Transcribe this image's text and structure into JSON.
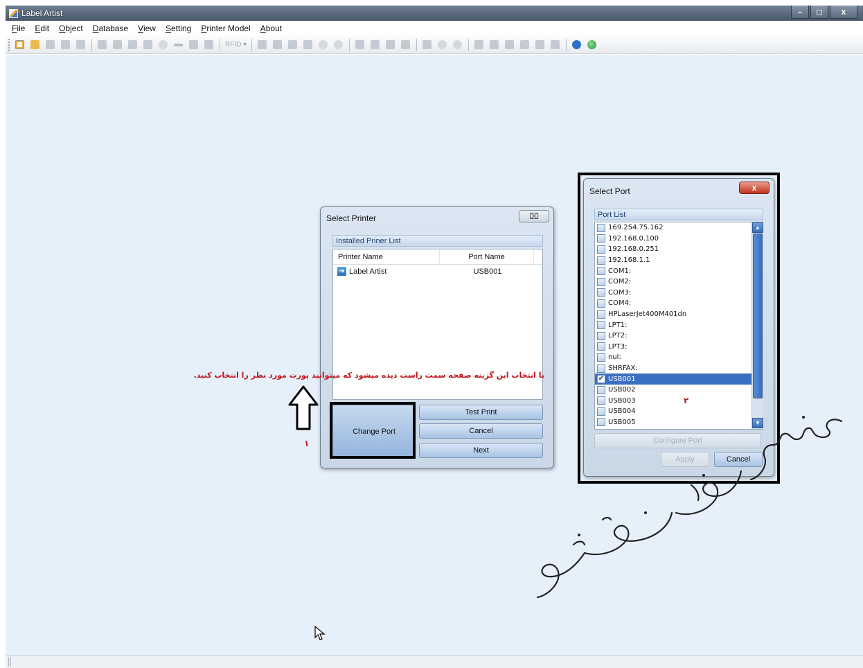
{
  "window": {
    "title": "Label Artist",
    "minimize": "–",
    "maximize": "◻",
    "close": "x"
  },
  "menu": [
    "File",
    "Edit",
    "Object",
    "Database",
    "View",
    "Setting",
    "Printer Model",
    "About"
  ],
  "toolbar": {
    "rfid_label": "RFID ▾",
    "active_tool": "new-document-icon"
  },
  "select_printer": {
    "title": "Select Printer",
    "close": "⌧",
    "group_title": "Installed Priner List",
    "columns": [
      "Printer Name",
      "Port Name"
    ],
    "rows": [
      {
        "name": "Label Artist",
        "port": "USB001"
      }
    ],
    "buttons": {
      "change_port": "Change Port",
      "test_print": "Test Print",
      "cancel": "Cancel",
      "next": "Next"
    }
  },
  "select_port": {
    "title": "Select Port",
    "close": "x",
    "group_title": "Port List",
    "ports": [
      {
        "name": "169.254.75.162",
        "checked": false
      },
      {
        "name": "192.168.0.100",
        "checked": false
      },
      {
        "name": "192.168.0.251",
        "checked": false
      },
      {
        "name": "192.168.1.1",
        "checked": false
      },
      {
        "name": "COM1:",
        "checked": false
      },
      {
        "name": "COM2:",
        "checked": false
      },
      {
        "name": "COM3:",
        "checked": false
      },
      {
        "name": "COM4:",
        "checked": false
      },
      {
        "name": "HPLaserJet400M401dn",
        "checked": false
      },
      {
        "name": "LPT1:",
        "checked": false
      },
      {
        "name": "LPT2:",
        "checked": false
      },
      {
        "name": "LPT3:",
        "checked": false
      },
      {
        "name": "nul:",
        "checked": false
      },
      {
        "name": "SHRFAX:",
        "checked": false
      },
      {
        "name": "USB001",
        "checked": true
      },
      {
        "name": "USB002",
        "checked": false
      },
      {
        "name": "USB003",
        "checked": false
      },
      {
        "name": "USB004",
        "checked": false
      },
      {
        "name": "USB005",
        "checked": false
      }
    ],
    "buttons": {
      "configure_port": "Configure Port",
      "apply": "Apply",
      "cancel": "Cancel"
    }
  },
  "annotations": {
    "instruction": "با انتخاب این گزینه صفحه سمت راست دیده میشود که میتوانید پورت مورد نظر را انتخاب کنید.",
    "step1": "۱",
    "step2": "۲",
    "watermark": "سماء رایان صنعت"
  },
  "colors": {
    "workspace": "#e6f0fa",
    "annotation_red": "#c0151a",
    "selection_blue": "#3b6fc2"
  }
}
